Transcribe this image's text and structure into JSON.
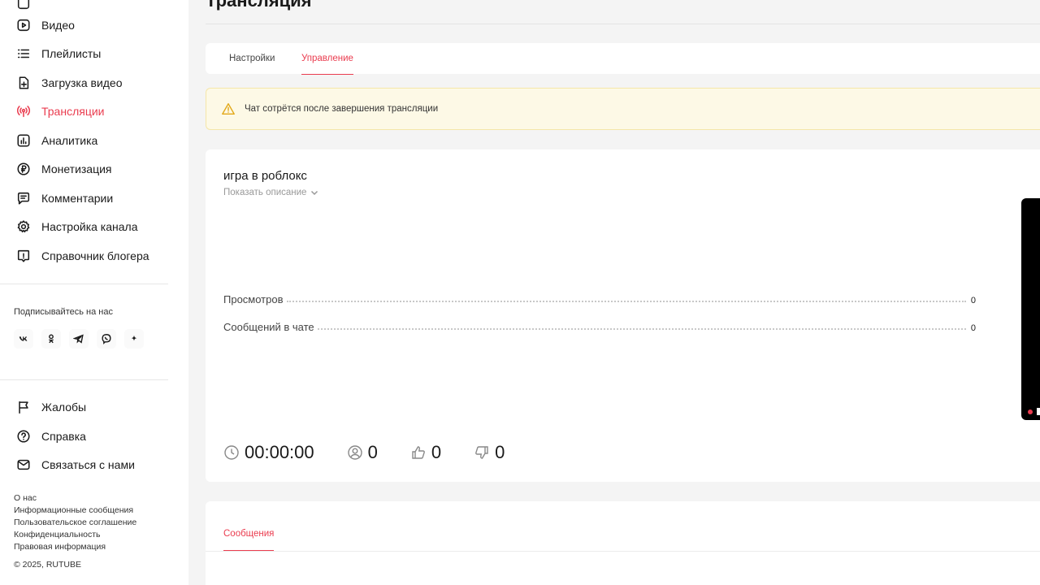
{
  "sidebar": {
    "items": [
      {
        "label": "Видео",
        "icon": "video-icon"
      },
      {
        "label": "Плейлисты",
        "icon": "playlist-icon"
      },
      {
        "label": "Загрузка видео",
        "icon": "upload-icon"
      },
      {
        "label": "Трансляции",
        "icon": "broadcast-icon",
        "active": true
      },
      {
        "label": "Аналитика",
        "icon": "analytics-icon"
      },
      {
        "label": "Монетизация",
        "icon": "ruble-icon"
      },
      {
        "label": "Комментарии",
        "icon": "comment-icon"
      },
      {
        "label": "Настройка канала",
        "icon": "gear-icon"
      },
      {
        "label": "Справочник блогера",
        "icon": "info-icon"
      }
    ],
    "follow_label": "Подписывайтесь на нас",
    "socials": [
      "vk-icon",
      "odnoklassniki-icon",
      "telegram-icon",
      "viber-icon",
      "sparkle-icon"
    ],
    "bottom_items": [
      {
        "label": "Жалобы",
        "icon": "flag-icon"
      },
      {
        "label": "Справка",
        "icon": "help-icon"
      },
      {
        "label": "Связаться с нами",
        "icon": "mail-icon"
      }
    ],
    "footer_links": [
      "О нас",
      "Информационные сообщения",
      "Пользовательское соглашение",
      "Конфиденциальность",
      "Правовая информация"
    ],
    "copyright": "© 2025, RUTUBE"
  },
  "main": {
    "page_title": "Трансляция",
    "tabs": [
      {
        "label": "Настройки"
      },
      {
        "label": "Управление",
        "active": true
      }
    ],
    "warning_text": "Чат сотрётся после завершения трансляции",
    "stream": {
      "title": "игра в роблокс",
      "show_description": "Показать описание",
      "stats": [
        {
          "label": "Просмотров",
          "value": "0"
        },
        {
          "label": "Сообщений в чате",
          "value": "0"
        }
      ],
      "duration": "00:00:00",
      "viewers": "0",
      "likes": "0",
      "dislikes": "0"
    },
    "messages_tab": "Сообщения"
  },
  "colors": {
    "accent": "#ea3c4f",
    "warning_bg": "#fdf9e6",
    "warning_icon": "#e2a818"
  }
}
